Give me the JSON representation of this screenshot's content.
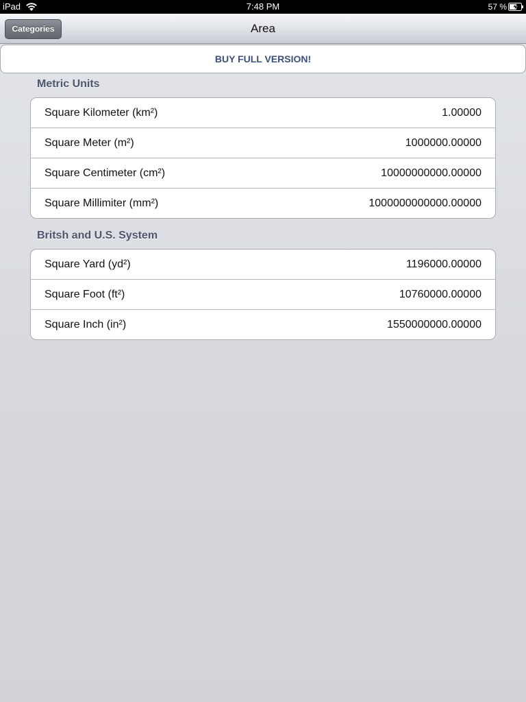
{
  "status_bar": {
    "device": "iPad",
    "time": "7:48 PM",
    "battery_percent": "57 %",
    "icons": [
      "wifi-icon",
      "battery-charging-icon"
    ]
  },
  "nav": {
    "title": "Area",
    "back_button": "Categories"
  },
  "buy_banner": "BUY FULL VERSION!",
  "sections": [
    {
      "header": "Metric Units",
      "rows": [
        {
          "label": "Square Kilometer (km²)",
          "value": "1.00000"
        },
        {
          "label": "Square Meter (m²)",
          "value": "1000000.00000"
        },
        {
          "label": "Square Centimeter (cm²)",
          "value": "10000000000.00000"
        },
        {
          "label": "Square Millimiter (mm²)",
          "value": "1000000000000.00000"
        }
      ]
    },
    {
      "header": "Britsh and U.S. System",
      "rows": [
        {
          "label": "Square Yard (yd²)",
          "value": "1196000.00000"
        },
        {
          "label": "Square Foot (ft²)",
          "value": "10760000.00000"
        },
        {
          "label": "Square Inch (in²)",
          "value": "1550000000.00000"
        }
      ]
    }
  ]
}
